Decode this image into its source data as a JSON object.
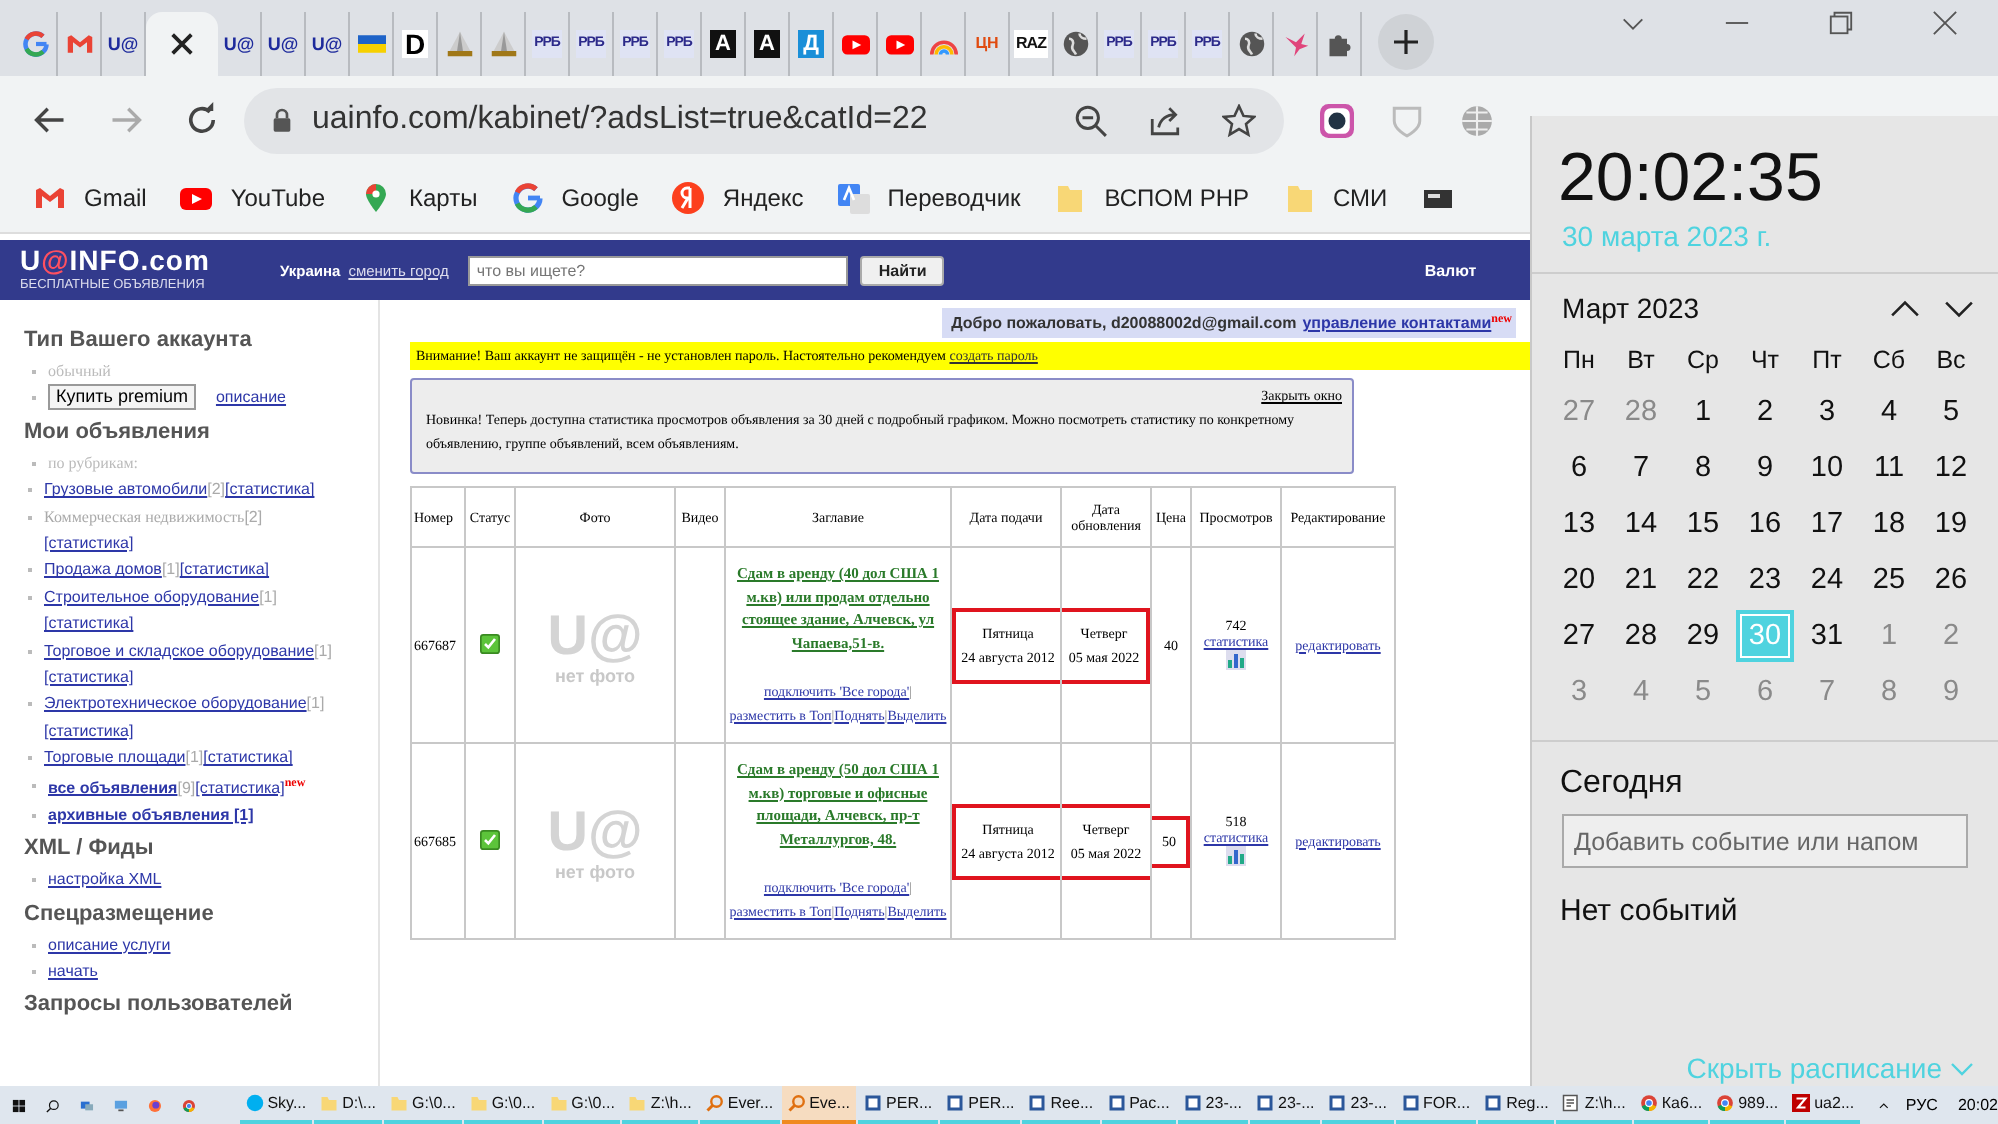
{
  "browser": {
    "tabs": [
      {
        "kind": "google",
        "selected": false
      },
      {
        "kind": "gmail",
        "selected": false
      },
      {
        "kind": "ua",
        "text": "U@",
        "selected": false
      },
      {
        "kind": "blank",
        "selected": true
      },
      {
        "kind": "ua",
        "text": "U@",
        "selected": false
      },
      {
        "kind": "ua",
        "text": "U@",
        "selected": false
      },
      {
        "kind": "ua",
        "text": "U@",
        "selected": false
      },
      {
        "kind": "flag",
        "selected": false
      },
      {
        "kind": "plain",
        "text": "D",
        "selected": false
      },
      {
        "kind": "pyramid",
        "selected": false
      },
      {
        "kind": "pyramid",
        "selected": false
      },
      {
        "kind": "rrb",
        "text": "РРБ",
        "selected": false
      },
      {
        "kind": "rrb",
        "text": "РРБ",
        "selected": false
      },
      {
        "kind": "rrb",
        "text": "РРБ",
        "selected": false
      },
      {
        "kind": "rrb",
        "text": "РРБ",
        "selected": false
      },
      {
        "kind": "dark",
        "text": "A",
        "selected": false
      },
      {
        "kind": "dark",
        "text": "A",
        "selected": false
      },
      {
        "kind": "blue",
        "text": "Д",
        "selected": false
      },
      {
        "kind": "youtube",
        "selected": false
      },
      {
        "kind": "youtube",
        "selected": false
      },
      {
        "kind": "rainbow",
        "selected": false
      },
      {
        "kind": "cn",
        "text": "ЦН",
        "selected": false
      },
      {
        "kind": "raz",
        "text": "RAZ",
        "selected": false
      },
      {
        "kind": "globe",
        "selected": false
      },
      {
        "kind": "rrb",
        "text": "РРБ",
        "selected": false
      },
      {
        "kind": "rrb",
        "text": "РРБ",
        "selected": false
      },
      {
        "kind": "rrb",
        "text": "РРБ",
        "selected": false
      },
      {
        "kind": "globe",
        "selected": false
      },
      {
        "kind": "bird",
        "selected": false
      },
      {
        "kind": "puzzle",
        "selected": false
      }
    ],
    "address": "uainfo.com/kabinet/?adsList=true&catId=22",
    "bookmarks": [
      {
        "kind": "gmail",
        "label": "Gmail"
      },
      {
        "kind": "youtube",
        "label": "YouTube"
      },
      {
        "kind": "maps",
        "label": "Карты"
      },
      {
        "kind": "google",
        "label": "Google"
      },
      {
        "kind": "yandex",
        "label": "Яндекс"
      },
      {
        "kind": "translate",
        "label": "Переводчик"
      },
      {
        "kind": "folder",
        "label": "ВСПОМ PHP"
      },
      {
        "kind": "folder",
        "label": "СМИ"
      },
      {
        "kind": "device"
      }
    ]
  },
  "site": {
    "logo_parts": [
      "U",
      "@",
      "INFO.com"
    ],
    "tagline": "БЕСПЛАТНЫЕ ОБЪЯВЛЕНИЯ",
    "region": "Украина",
    "change_city": "сменить город",
    "search": {
      "placeholder": "что вы ищете?"
    },
    "search_button": "Найти",
    "currency": "Валют"
  },
  "sidebar": {
    "sections": [
      {
        "title": "Тип Вашего аккаунта",
        "items": [
          {
            "kind": "muted",
            "text": "обычный"
          },
          {
            "kind": "premium",
            "button": "Купить premium",
            "link": "описание"
          }
        ]
      },
      {
        "title": "Мои объявления",
        "items": [
          {
            "kind": "muted",
            "text": "по рубрикам:",
            "children": [
              {
                "name": "Грузовые автомобили",
                "disabled": false,
                "count": "[2]",
                "stats": "[статистика]"
              },
              {
                "name": "Коммерческая недвижимость",
                "disabled": true,
                "count": "[2]",
                "stats": "[статистика]"
              },
              {
                "name": "Продажа домов",
                "disabled": false,
                "count": "[1]",
                "stats": "[статистика]"
              },
              {
                "name": "Строительное оборудование",
                "disabled": false,
                "count": "[1]",
                "stats": "[статистика]"
              },
              {
                "name": "Торговое и складское оборудование",
                "disabled": false,
                "count": "[1]",
                "stats": "[статистика]"
              },
              {
                "name": "Электротехническое оборудование",
                "disabled": false,
                "count": "[1]",
                "stats": "[статистика]"
              },
              {
                "name": "Торговые площади",
                "disabled": false,
                "count": "[1]",
                "stats": "[статистика]"
              }
            ]
          },
          {
            "kind": "bold-link",
            "text": "все объявления",
            "count": "[9]",
            "stats": "[статистика]",
            "badge": "new"
          },
          {
            "kind": "bold-link",
            "text": "архивные объявления [1]"
          }
        ]
      },
      {
        "title": "XML / Фиды",
        "items": [
          {
            "kind": "link",
            "text": "настройка XML"
          }
        ]
      },
      {
        "title": "Спецразмещение",
        "items": [
          {
            "kind": "link",
            "text": "описание услуги"
          },
          {
            "kind": "link",
            "text": "начать"
          }
        ]
      },
      {
        "title": "Запросы пользователей"
      }
    ]
  },
  "welcome": {
    "text": "Добро пожаловать, d20088002d@gmail.com",
    "link": "управление контактами",
    "badge": "new"
  },
  "warning": {
    "text": "Внимание! Ваш аккаунт не защищён - не установлен пароль. Настоятельно рекомендуем",
    "link": "создать пароль"
  },
  "notice": {
    "close": "Закрыть окно",
    "text": "Новинка! Теперь доступна статистика просмотров объявления за 30 дней с подробный графиком. Можно посмотреть статистику по конкретному объявлению, группе объявлений, всем объявлениям."
  },
  "table": {
    "columns": [
      "Номер",
      "Статус",
      "Фото",
      "Видео",
      "Заглавие",
      "Дата подачи",
      "Дата обновления",
      "Цена",
      "Просмотров",
      "Редактирование"
    ],
    "separator": "|",
    "rows": [
      {
        "number": "667687",
        "active": true,
        "photo_logo": "U@",
        "photo_text": "нет фото",
        "title": "Сдам в аренду (40 дол США 1 м.кв) или продам отдельно стоящее здание, Алчевск, ул Чапаева,51-в.",
        "actions": [
          "подключить 'Все города'",
          "разместить в Топ",
          "Поднять",
          "Выделить"
        ],
        "posted_day": "Пятница",
        "posted_date": "24 августа 2012",
        "updated_day": "Четверг",
        "updated_date": "05 мая 2022",
        "price": "40",
        "views": "742",
        "stats": "статистика",
        "edit": "редактировать",
        "dates_highlighted": true,
        "price_highlighted": false
      },
      {
        "number": "667685",
        "active": true,
        "photo_logo": "U@",
        "photo_text": "нет фото",
        "title": "Сдам в аренду (50 дол США 1 м.кв) торговые и офисные площади, Алчевск, пр-т Металлургов, 48.",
        "actions": [
          "подключить 'Все города'",
          "разместить в Топ",
          "Поднять",
          "Выделить"
        ],
        "posted_day": "Пятница",
        "posted_date": "24 августа 2012",
        "updated_day": "Четверг",
        "updated_date": "05 мая 2022",
        "price": "50",
        "views": "518",
        "stats": "статистика",
        "edit": "редактировать",
        "dates_highlighted": true,
        "price_highlighted": true
      }
    ]
  },
  "calendar": {
    "time": "20:02:35",
    "date": "30 марта 2023 г.",
    "month": "Март 2023",
    "weekdays": [
      "Пн",
      "Вт",
      "Ср",
      "Чт",
      "Пт",
      "Сб",
      "Вс"
    ],
    "days": [
      {
        "day": "27",
        "muted": true,
        "selected": false
      },
      {
        "day": "28",
        "muted": true,
        "selected": false
      },
      {
        "day": "1",
        "muted": false,
        "selected": false
      },
      {
        "day": "2",
        "muted": false,
        "selected": false
      },
      {
        "day": "3",
        "muted": false,
        "selected": false
      },
      {
        "day": "4",
        "muted": false,
        "selected": false
      },
      {
        "day": "5",
        "muted": false,
        "selected": false
      },
      {
        "day": "6",
        "muted": false,
        "selected": false
      },
      {
        "day": "7",
        "muted": false,
        "selected": false
      },
      {
        "day": "8",
        "muted": false,
        "selected": false
      },
      {
        "day": "9",
        "muted": false,
        "selected": false
      },
      {
        "day": "10",
        "muted": false,
        "selected": false
      },
      {
        "day": "11",
        "muted": false,
        "selected": false
      },
      {
        "day": "12",
        "muted": false,
        "selected": false
      },
      {
        "day": "13",
        "muted": false,
        "selected": false
      },
      {
        "day": "14",
        "muted": false,
        "selected": false
      },
      {
        "day": "15",
        "muted": false,
        "selected": false
      },
      {
        "day": "16",
        "muted": false,
        "selected": false
      },
      {
        "day": "17",
        "muted": false,
        "selected": false
      },
      {
        "day": "18",
        "muted": false,
        "selected": false
      },
      {
        "day": "19",
        "muted": false,
        "selected": false
      },
      {
        "day": "20",
        "muted": false,
        "selected": false
      },
      {
        "day": "21",
        "muted": false,
        "selected": false
      },
      {
        "day": "22",
        "muted": false,
        "selected": false
      },
      {
        "day": "23",
        "muted": false,
        "selected": false
      },
      {
        "day": "24",
        "muted": false,
        "selected": false
      },
      {
        "day": "25",
        "muted": false,
        "selected": false
      },
      {
        "day": "26",
        "muted": false,
        "selected": false
      },
      {
        "day": "27",
        "muted": false,
        "selected": false
      },
      {
        "day": "28",
        "muted": false,
        "selected": false
      },
      {
        "day": "29",
        "muted": false,
        "selected": false
      },
      {
        "day": "30",
        "muted": false,
        "selected": true
      },
      {
        "day": "31",
        "muted": false,
        "selected": false
      },
      {
        "day": "1",
        "muted": true,
        "selected": false
      },
      {
        "day": "2",
        "muted": true,
        "selected": false
      },
      {
        "day": "3",
        "muted": true,
        "selected": false
      },
      {
        "day": "4",
        "muted": true,
        "selected": false
      },
      {
        "day": "5",
        "muted": true,
        "selected": false
      },
      {
        "day": "6",
        "muted": true,
        "selected": false
      },
      {
        "day": "7",
        "muted": true,
        "selected": false
      },
      {
        "day": "8",
        "muted": true,
        "selected": false
      },
      {
        "day": "9",
        "muted": true,
        "selected": false
      }
    ],
    "today_label": "Сегодня",
    "event_field": {
      "placeholder": "Добавить событие или напом"
    },
    "no_events": "Нет событий",
    "hide": "Скрыть расписание"
  },
  "taskbar": {
    "items": [
      {
        "kind": "skype",
        "label": "Sky...",
        "selected": false
      },
      {
        "kind": "folder",
        "label": "D:\\...",
        "selected": false
      },
      {
        "kind": "folder",
        "label": "G:\\0...",
        "selected": false
      },
      {
        "kind": "folder",
        "label": "G:\\0...",
        "selected": false
      },
      {
        "kind": "folder",
        "label": "G:\\0...",
        "selected": false
      },
      {
        "kind": "folder",
        "label": "Z:\\h...",
        "selected": false
      },
      {
        "kind": "search",
        "label": "Ever...",
        "selected": false
      },
      {
        "kind": "search",
        "label": "Eve...",
        "selected": true
      },
      {
        "kind": "doc",
        "label": "PER...",
        "selected": false
      },
      {
        "kind": "doc",
        "label": "PER...",
        "selected": false
      },
      {
        "kind": "doc",
        "label": "Ree...",
        "selected": false
      },
      {
        "kind": "doc",
        "label": "Рас...",
        "selected": false
      },
      {
        "kind": "doc",
        "label": "23-...",
        "selected": false
      },
      {
        "kind": "doc",
        "label": "23-...",
        "selected": false
      },
      {
        "kind": "doc",
        "label": "23-...",
        "selected": false
      },
      {
        "kind": "doc",
        "label": "FOR...",
        "selected": false
      },
      {
        "kind": "doc",
        "label": "Reg...",
        "selected": false
      },
      {
        "kind": "notepad",
        "label": "Z:\\h...",
        "selected": false
      },
      {
        "kind": "chrome",
        "label": "Ка6...",
        "selected": false
      },
      {
        "kind": "chrome",
        "label": "989...",
        "selected": false
      },
      {
        "kind": "ftp",
        "label": "ua2...",
        "selected": false
      }
    ],
    "language": "РУС",
    "time": "20:02"
  }
}
